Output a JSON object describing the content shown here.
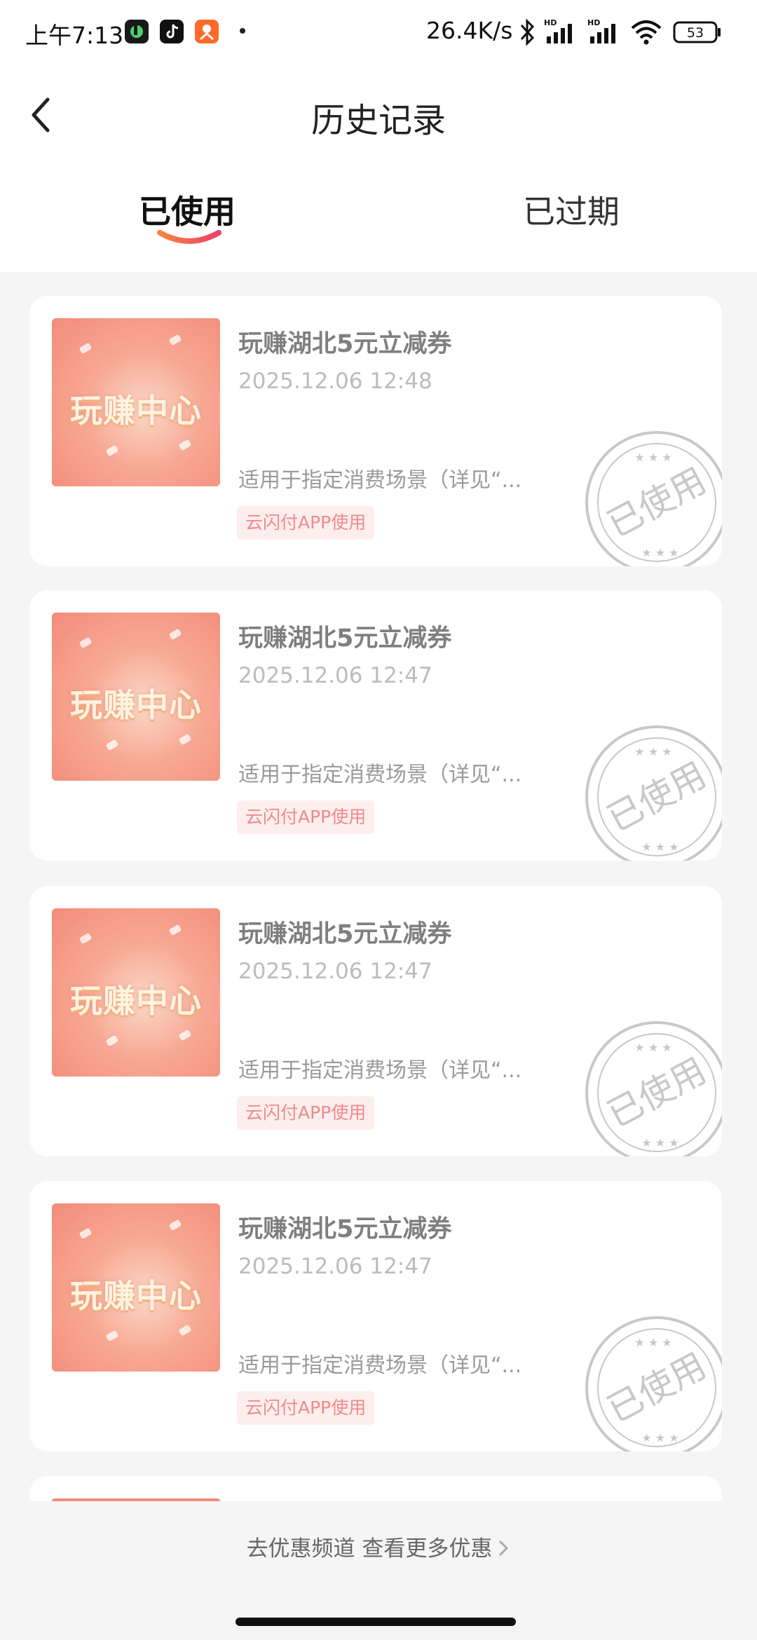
{
  "status_bar": {
    "time": "上午7:13",
    "speed": "26.4K/s",
    "battery": "53"
  },
  "header": {
    "title": "历史记录"
  },
  "tabs": [
    {
      "label": "已使用",
      "active": true
    },
    {
      "label": "已过期",
      "active": false
    }
  ],
  "coupons": [
    {
      "image_text": "玩赚中心",
      "title": "玩赚湖北5元立减券",
      "time": "2025.12.06 12:48",
      "desc": "适用于指定消费场景（详见“...",
      "tag": "云闪付APP使用",
      "stamp": "已使用"
    },
    {
      "image_text": "玩赚中心",
      "title": "玩赚湖北5元立减券",
      "time": "2025.12.06 12:47",
      "desc": "适用于指定消费场景（详见“...",
      "tag": "云闪付APP使用",
      "stamp": "已使用"
    },
    {
      "image_text": "玩赚中心",
      "title": "玩赚湖北5元立减券",
      "time": "2025.12.06 12:47",
      "desc": "适用于指定消费场景（详见“...",
      "tag": "云闪付APP使用",
      "stamp": "已使用"
    },
    {
      "image_text": "玩赚中心",
      "title": "玩赚湖北5元立减券",
      "time": "2025.12.06 12:47",
      "desc": "适用于指定消费场景（详见“...",
      "tag": "云闪付APP使用",
      "stamp": "已使用"
    }
  ],
  "footer": {
    "link_text": "去优惠频道 查看更多优惠"
  },
  "colors": {
    "accent": "#f15b6c",
    "tag_text": "#f08a8a",
    "tag_bg": "#fdeeee",
    "page_bg": "#f5f5f5"
  },
  "icons": [
    "back-arrow-icon",
    "bluetooth-icon",
    "signal-icon",
    "wifi-icon",
    "battery-icon",
    "chevron-right-icon"
  ]
}
